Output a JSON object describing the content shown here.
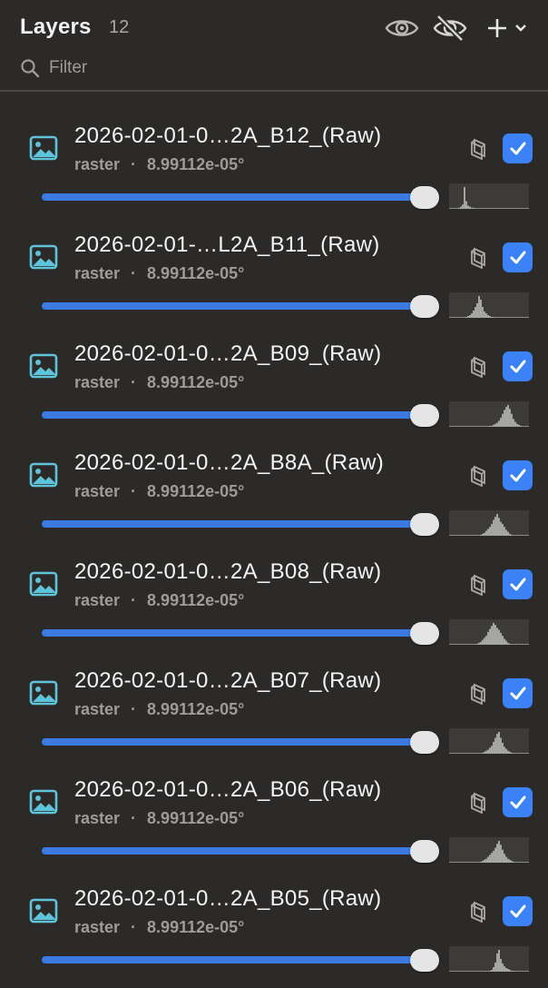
{
  "header": {
    "title": "Layers",
    "count": "12",
    "filter_placeholder": "Filter",
    "icons": [
      "eye-icon",
      "eye-off-icon",
      "plus-icon",
      "chevron-down-icon"
    ]
  },
  "colors": {
    "accent": "#3a82f6",
    "thumb_icon": "#5fc3d9",
    "background": "#2b2a28",
    "histogram": "#a5a5a3"
  },
  "layers": [
    {
      "name": "2026-02-01-0…2A_B12_(Raw)",
      "type": "raster",
      "resolution": "8.99112e-05°",
      "visible": true,
      "opacity": 1.0,
      "histogram": [
        0,
        0,
        0,
        0,
        0,
        1,
        2,
        4,
        20,
        7,
        3,
        2,
        1,
        1,
        0,
        0,
        0,
        0,
        0,
        0,
        0,
        0,
        0,
        0,
        0,
        0,
        0,
        0,
        0,
        0,
        0,
        0,
        0,
        0,
        0,
        0,
        0,
        0,
        0,
        0,
        0,
        0,
        0,
        0
      ]
    },
    {
      "name": "2026-02-01-…L2A_B11_(Raw)",
      "type": "raster",
      "resolution": "8.99112e-05°",
      "visible": true,
      "opacity": 1.0,
      "histogram": [
        0,
        0,
        0,
        0,
        0,
        0,
        0,
        0,
        0,
        1,
        2,
        3,
        5,
        8,
        12,
        16,
        24,
        20,
        12,
        7,
        5,
        3,
        2,
        1,
        1,
        0,
        0,
        0,
        0,
        0,
        0,
        0,
        0,
        0,
        0,
        0,
        0,
        0,
        0,
        0,
        0,
        0,
        0,
        0
      ]
    },
    {
      "name": "2026-02-01-0…2A_B09_(Raw)",
      "type": "raster",
      "resolution": "8.99112e-05°",
      "visible": true,
      "opacity": 1.0,
      "histogram": [
        0,
        0,
        0,
        0,
        0,
        0,
        0,
        0,
        0,
        0,
        0,
        0,
        0,
        0,
        0,
        0,
        0,
        0,
        0,
        0,
        0,
        0,
        1,
        1,
        2,
        3,
        4,
        6,
        9,
        13,
        17,
        20,
        22,
        18,
        13,
        8,
        5,
        3,
        2,
        1,
        0,
        0,
        0,
        0
      ]
    },
    {
      "name": "2026-02-01-0…2A_B8A_(Raw)",
      "type": "raster",
      "resolution": "8.99112e-05°",
      "visible": true,
      "opacity": 1.0,
      "histogram": [
        0,
        0,
        0,
        0,
        0,
        0,
        0,
        0,
        0,
        0,
        0,
        0,
        0,
        0,
        0,
        0,
        0,
        1,
        2,
        3,
        5,
        7,
        9,
        12,
        16,
        19,
        22,
        18,
        14,
        12,
        9,
        6,
        4,
        2,
        1,
        0,
        0,
        0,
        0,
        0,
        0,
        0,
        0,
        0
      ]
    },
    {
      "name": "2026-02-01-0…2A_B08_(Raw)",
      "type": "raster",
      "resolution": "8.99112e-05°",
      "visible": true,
      "opacity": 1.0,
      "histogram": [
        0,
        0,
        0,
        0,
        0,
        0,
        0,
        0,
        0,
        0,
        0,
        0,
        0,
        0,
        0,
        1,
        2,
        3,
        5,
        7,
        9,
        13,
        16,
        19,
        22,
        20,
        17,
        15,
        12,
        9,
        6,
        4,
        2,
        1,
        0,
        0,
        0,
        0,
        0,
        0,
        0,
        0,
        0,
        0
      ]
    },
    {
      "name": "2026-02-01-0…2A_B07_(Raw)",
      "type": "raster",
      "resolution": "8.99112e-05°",
      "visible": true,
      "opacity": 1.0,
      "histogram": [
        0,
        0,
        0,
        0,
        0,
        0,
        0,
        0,
        0,
        0,
        0,
        0,
        0,
        0,
        0,
        0,
        0,
        0,
        1,
        2,
        3,
        4,
        6,
        8,
        12,
        16,
        20,
        22,
        16,
        11,
        7,
        5,
        3,
        2,
        1,
        0,
        0,
        0,
        0,
        0,
        0,
        0,
        0,
        0
      ]
    },
    {
      "name": "2026-02-01-0…2A_B06_(Raw)",
      "type": "raster",
      "resolution": "8.99112e-05°",
      "visible": true,
      "opacity": 1.0,
      "histogram": [
        0,
        0,
        0,
        0,
        0,
        0,
        0,
        0,
        0,
        0,
        0,
        0,
        0,
        0,
        0,
        0,
        0,
        1,
        2,
        3,
        4,
        6,
        8,
        10,
        12,
        15,
        19,
        22,
        18,
        13,
        9,
        6,
        4,
        3,
        2,
        1,
        0,
        0,
        0,
        0,
        0,
        0,
        0,
        0
      ]
    },
    {
      "name": "2026-02-01-0…2A_B05_(Raw)",
      "type": "raster",
      "resolution": "8.99112e-05°",
      "visible": true,
      "opacity": 1.0,
      "histogram": [
        0,
        0,
        0,
        0,
        0,
        0,
        0,
        0,
        0,
        0,
        0,
        0,
        0,
        0,
        0,
        0,
        0,
        0,
        0,
        0,
        0,
        0,
        1,
        2,
        5,
        10,
        20,
        24,
        14,
        9,
        6,
        4,
        3,
        2,
        1,
        1,
        0,
        0,
        0,
        0,
        0,
        0,
        0,
        0
      ]
    }
  ]
}
